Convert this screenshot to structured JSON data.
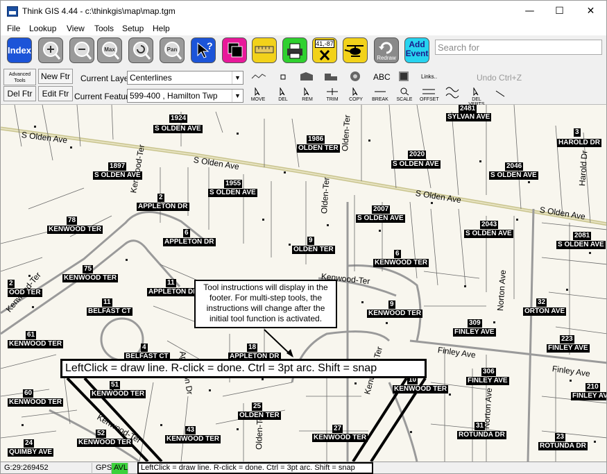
{
  "window": {
    "title": "Think GIS 4.44 - c:\\thinkgis\\map\\map.tgm",
    "minimize": "—",
    "maximize": "☐",
    "close": "✕"
  },
  "menu": [
    "File",
    "Lookup",
    "View",
    "Tools",
    "Setup",
    "Help"
  ],
  "toolbar": {
    "index_label": "Index",
    "max_label": "Max",
    "pan_label": "Pan",
    "coords_label": "41,-87",
    "redraw_label": "Redraw",
    "add_event_label": "Add\nEvent",
    "search_placeholder": "Search for"
  },
  "edit_toolbar": {
    "advanced_tools_label": "Advanced Tools",
    "new_ftr": "New Ftr",
    "del_ftr": "Del Ftr",
    "edit_ftr": "Edit Ftr",
    "current_layer_label": "Current Layer",
    "current_layer_value": "Centerlines",
    "current_feature_label": "Current Feature",
    "current_feature_value": "599-400 , Hamilton Twp",
    "abc_label": "ABC",
    "links_label": "Links..",
    "undo_label": "Undo  Ctrl+Z",
    "tools": [
      "MOVE",
      "DEL",
      "REM",
      "TRIM",
      "COPY",
      "BREAK",
      "SCALE",
      "OFFSET",
      "DEL VERTS"
    ]
  },
  "map": {
    "street_names": [
      {
        "text": "S Olden Ave"
      },
      {
        "text": "S Olden Ave"
      },
      {
        "text": "S Olden Ave"
      },
      {
        "text": "S Olden Ave"
      },
      {
        "text": "Kenwood-Ter"
      },
      {
        "text": "Kenwood-Ter"
      },
      {
        "text": "Kenwood-Ter"
      },
      {
        "text": "Kenwood-Ter"
      },
      {
        "text": "Olden-Ter"
      },
      {
        "text": "Olden-Ter"
      },
      {
        "text": "Norton Ave"
      },
      {
        "text": "Norton Ave"
      },
      {
        "text": "Finley Ave"
      },
      {
        "text": "Finley Ave"
      },
      {
        "text": "Harold Dr"
      },
      {
        "text": "Appleton Dr"
      },
      {
        "text": "Kenwood-Ter"
      },
      {
        "text": "Olden-Ter"
      }
    ],
    "parcel_labels": [
      {
        "num": "1924",
        "street": "S OLDEN AVE"
      },
      {
        "num": "1986",
        "street": "OLDEN TER"
      },
      {
        "num": "2481",
        "street": "SYLVAN AVE"
      },
      {
        "num": "3",
        "street": "HAROLD DR"
      },
      {
        "num": "1897",
        "street": "S OLDEN AVE"
      },
      {
        "num": "1955",
        "street": "S OLDEN AVE"
      },
      {
        "num": "2020",
        "street": "S OLDEN AVE"
      },
      {
        "num": "2046",
        "street": "S OLDEN AVE"
      },
      {
        "num": "2",
        "street": "APPLETON DR"
      },
      {
        "num": "78",
        "street": "KENWOOD TER"
      },
      {
        "num": "2007",
        "street": "S OLDEN AVE"
      },
      {
        "num": "2043",
        "street": "S OLDEN AVE"
      },
      {
        "num": "2081",
        "street": "S OLDEN AVE"
      },
      {
        "num": "6",
        "street": "APPLETON DR"
      },
      {
        "num": "9",
        "street": "OLDEN TER"
      },
      {
        "num": "6",
        "street": "KENWOOD TER"
      },
      {
        "num": "75",
        "street": "KENWOOD TER"
      },
      {
        "num": "11",
        "street": "APPLETON DR"
      },
      {
        "num": "2",
        "street": "OOD TER"
      },
      {
        "num": "11",
        "street": "BELFAST CT"
      },
      {
        "num": "9",
        "street": "KENWOOD TER"
      },
      {
        "num": "32",
        "street": "ORTON AVE"
      },
      {
        "num": "61",
        "street": "KENWOOD TER"
      },
      {
        "num": "309",
        "street": "FINLEY AVE"
      },
      {
        "num": "223",
        "street": "FINLEY AVE"
      },
      {
        "num": "4",
        "street": "BELFAST CT"
      },
      {
        "num": "18",
        "street": "APPLETON DR"
      },
      {
        "num": "306",
        "street": "FINLEY AVE"
      },
      {
        "num": "210",
        "street": "FINLEY AVE"
      },
      {
        "num": "51",
        "street": "KENWOOD TER"
      },
      {
        "num": "60",
        "street": "KENWOOD TER"
      },
      {
        "num": "10",
        "street": "KENWOOD TER"
      },
      {
        "num": "25",
        "street": "OLDEN TER"
      },
      {
        "num": "52",
        "street": "KENWOOD TER"
      },
      {
        "num": "43",
        "street": "KENWOOD TER"
      },
      {
        "num": "27",
        "street": "KENWOOD TER"
      },
      {
        "num": "31",
        "street": "ROTUNDA DR"
      },
      {
        "num": "23",
        "street": "ROTUNDA DR"
      },
      {
        "num": "24",
        "street": "QUIMBY AVE"
      }
    ],
    "callout_text": "Tool instructions will display in the footer. For multi-step tools, the instructions will change after the initial tool function is activated.",
    "zoomed_instruction": "LeftClick = draw line. R-click = done. Ctrl = 3pt arc. Shift = snap"
  },
  "status": {
    "coords": "G:29:269452",
    "gps": "GPS",
    "avl": "AVL",
    "footer": "LeftClick = draw line. R-click = done. Ctrl = 3pt arc. Shift = snap"
  },
  "colors": {
    "avl_bg": "#3bd13b",
    "map_bg": "#f8f6ee",
    "main_road": "#d8d4a8"
  }
}
